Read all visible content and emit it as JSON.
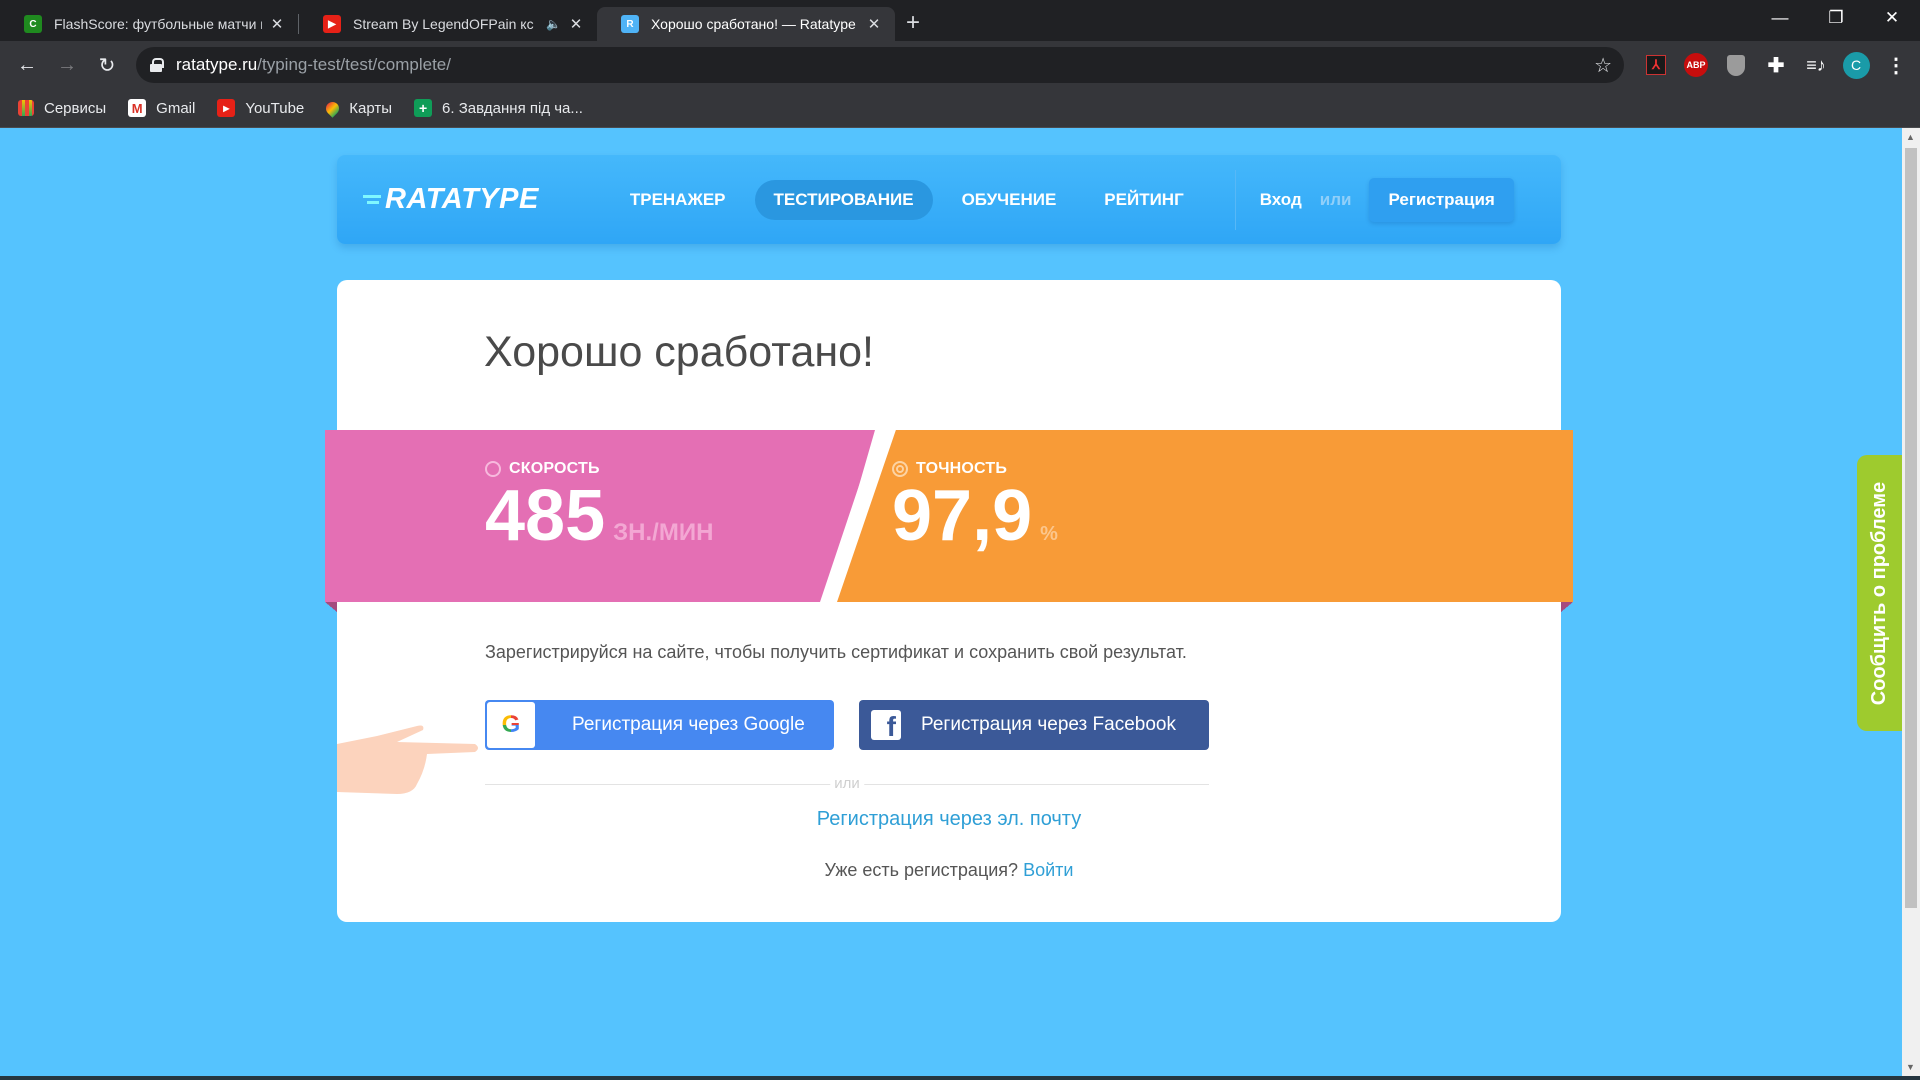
{
  "browser": {
    "tabs": [
      {
        "title": "FlashScore: футбольные матчи и",
        "icon": "flashscore-favicon",
        "active": false
      },
      {
        "title": "Stream By LegendOFPain кс",
        "icon": "youtube-favicon",
        "active": false,
        "audio": true
      },
      {
        "title": "Хорошо сработано! — Ratatype",
        "icon": "ratatype-favicon",
        "active": true
      }
    ],
    "new_tab": "+",
    "url_host": "ratatype.ru",
    "url_path": "/typing-test/test/complete/",
    "extensions": [
      "adobe-acrobat-icon",
      "adblock-plus-icon",
      "shield-icon",
      "puzzle-extensions-icon",
      "media-queue-icon"
    ],
    "abp_label": "ABP",
    "profile_initial": "C",
    "bookmarks": [
      {
        "label": "Сервисы",
        "icon": "apps-grid-icon"
      },
      {
        "label": "Gmail",
        "icon": "gmail-icon"
      },
      {
        "label": "YouTube",
        "icon": "youtube-icon"
      },
      {
        "label": "Карты",
        "icon": "maps-pin-icon"
      },
      {
        "label": "6. Завдання під ча...",
        "icon": "google-sheets-icon"
      }
    ]
  },
  "site": {
    "logo": "RATATYPE",
    "nav": [
      {
        "label": "ТРЕНАЖЕР",
        "active": false
      },
      {
        "label": "ТЕСТИРОВАНИЕ",
        "active": true
      },
      {
        "label": "ОБУЧЕНИЕ",
        "active": false
      },
      {
        "label": "РЕЙТИНГ",
        "active": false
      }
    ],
    "login": "Вход",
    "or": "или",
    "register": "Регистрация"
  },
  "result": {
    "title": "Хорошо сработано!",
    "speed": {
      "label": "СКОРОСТЬ",
      "value": "485",
      "unit": "ЗН./МИН"
    },
    "accuracy": {
      "label": "ТОЧНОСТЬ",
      "value": "97,9",
      "unit": "%"
    },
    "promo": "Зарегистрируйся на сайте, чтобы получить сертификат и сохранить свой результат.",
    "google_button": "Регистрация через Google",
    "facebook_button": "Регистрация через Facebook",
    "divider": "или",
    "email_link": "Регистрация через эл. почту",
    "have_account": "Уже есть регистрация?",
    "login_link": "Войти"
  },
  "report_tab": "Сообщить о проблеме",
  "colors": {
    "page_bg": "#55c3fe",
    "speed": "#e46fb4",
    "accuracy": "#f89b37",
    "google": "#4688f1",
    "facebook": "#3b5998",
    "report": "#9ecb2e",
    "link": "#2f9fd6"
  }
}
